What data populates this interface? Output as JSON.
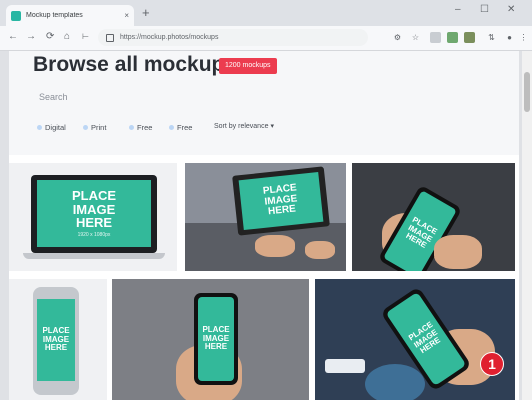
{
  "browser": {
    "tab_title": "Mockup templates",
    "tab_close": "×",
    "new_tab": "+",
    "minimize": "–",
    "maximize": "☐",
    "close": "✕",
    "back": "←",
    "forward": "→",
    "reload": "⟳",
    "home": "⌂",
    "url": "https://mockup.photos/mockups"
  },
  "page": {
    "title": "Browse all mockups",
    "badge": "1200 mockups",
    "search_placeholder": "Search",
    "filters": [
      "Digital",
      "Print",
      "Free",
      "Free"
    ],
    "sort_label": "Sort by relevance"
  },
  "thumbs": [
    {
      "line1": "PLACE",
      "line2": "IMAGE",
      "line3": "HERE",
      "caption": "1920 x 1080px"
    },
    {
      "line1": "PLACE",
      "line2": "IMAGE",
      "line3": "HERE",
      "caption": ""
    },
    {
      "line1": "PLACE",
      "line2": "IMAGE",
      "line3": "HERE",
      "caption": ""
    },
    {
      "line1": "PLACE",
      "line2": "IMAGE",
      "line3": "HERE",
      "caption": ""
    },
    {
      "line1": "PLACE",
      "line2": "IMAGE",
      "line3": "HERE",
      "caption": ""
    },
    {
      "line1": "PLACE",
      "line2": "IMAGE",
      "line3": "HERE",
      "caption": ""
    }
  ],
  "step_badge": "1",
  "colors": {
    "accent": "#ec3c4f",
    "screen": "#33b99a",
    "badge_marker": "#e02030"
  }
}
